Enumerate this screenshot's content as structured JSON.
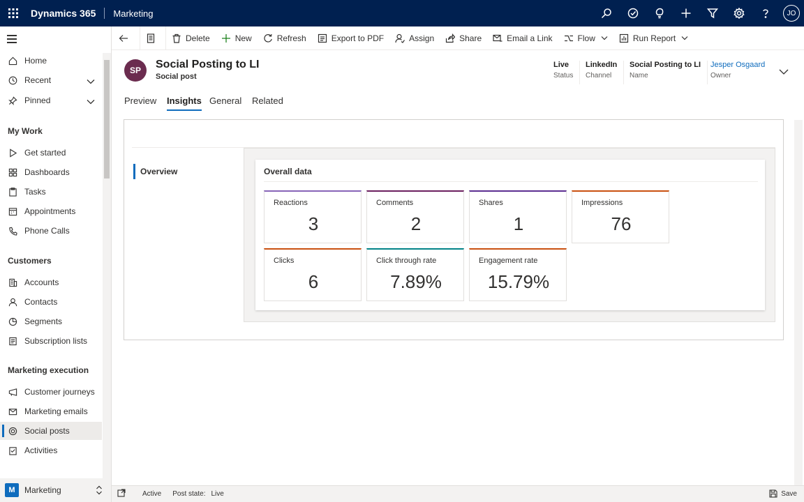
{
  "topbar": {
    "brand": "Dynamics 365",
    "app": "Marketing",
    "user_initials": "JO",
    "icons": [
      "search-icon",
      "task-icon",
      "lightbulb-icon",
      "plus-icon",
      "filter-icon",
      "gear-icon",
      "help-icon"
    ]
  },
  "sidebar": {
    "items": {
      "home": "Home",
      "recent": "Recent",
      "pinned": "Pinned",
      "get_started": "Get started",
      "dashboards": "Dashboards",
      "tasks": "Tasks",
      "appointments": "Appointments",
      "phone_calls": "Phone Calls",
      "accounts": "Accounts",
      "contacts": "Contacts",
      "segments": "Segments",
      "subscription_lists": "Subscription lists",
      "customer_journeys": "Customer journeys",
      "marketing_emails": "Marketing emails",
      "social_posts": "Social posts",
      "activities": "Activities"
    },
    "groups": {
      "my_work": "My Work",
      "customers": "Customers",
      "marketing_execution": "Marketing execution"
    },
    "area": {
      "badge": "M",
      "label": "Marketing"
    }
  },
  "commandbar": {
    "delete": "Delete",
    "new": "New",
    "refresh": "Refresh",
    "export_pdf": "Export to PDF",
    "assign": "Assign",
    "share": "Share",
    "email_link": "Email a Link",
    "flow": "Flow",
    "run_report": "Run Report"
  },
  "record": {
    "initials": "SP",
    "title": "Social Posting to LI",
    "entity": "Social post",
    "fields": {
      "status": {
        "value": "Live",
        "label": "Status"
      },
      "channel": {
        "value": "LinkedIn",
        "label": "Channel"
      },
      "name": {
        "value": "Social Posting to LI",
        "label": "Name"
      },
      "owner": {
        "value": "Jesper Osgaard",
        "label": "Owner"
      }
    }
  },
  "tabs": {
    "preview": "Preview",
    "insights": "Insights",
    "general": "General",
    "related": "Related"
  },
  "insights": {
    "nav_overview": "Overview",
    "card_title": "Overall data",
    "metrics": [
      {
        "label": "Reactions",
        "value": "3",
        "color": "#8764b8"
      },
      {
        "label": "Comments",
        "value": "2",
        "color": "#6b1f5f"
      },
      {
        "label": "Shares",
        "value": "1",
        "color": "#5c2e91"
      },
      {
        "label": "Impressions",
        "value": "76",
        "color": "#ca5010"
      },
      {
        "label": "Clicks",
        "value": "6",
        "color": "#ca5010"
      },
      {
        "label": "Click through rate",
        "value": "7.89%",
        "color": "#038387"
      },
      {
        "label": "Engagement rate",
        "value": "15.79%",
        "color": "#ca5010"
      }
    ]
  },
  "footer": {
    "state": "Active",
    "post_state_label": "Post state:",
    "post_state_value": "Live",
    "save": "Save"
  },
  "colors": {
    "topbar": "#002050",
    "accent": "#0f6cbd",
    "record_avatar": "#6b2c4f"
  }
}
